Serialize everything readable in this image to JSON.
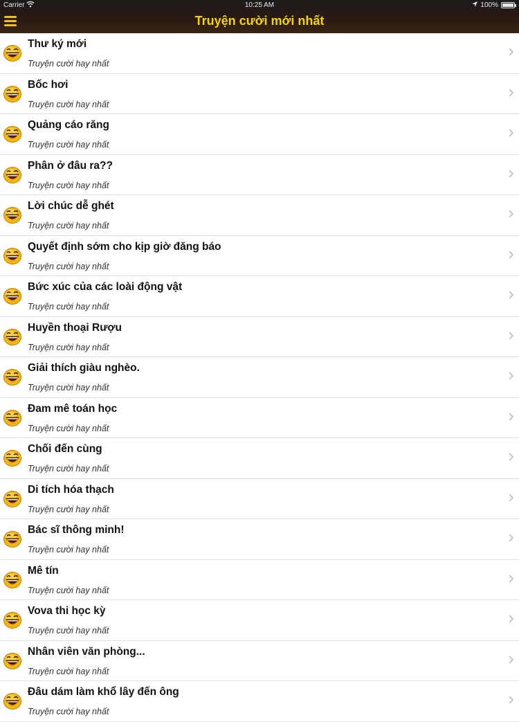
{
  "status_bar": {
    "carrier": "Carrier",
    "time": "10:25 AM",
    "battery": "100%",
    "battery_level": 1.0
  },
  "header": {
    "title": "Truyện cười mới nhất",
    "menu_icon": "hamburger-menu-icon"
  },
  "colors": {
    "header_title": "#f5d400",
    "menu_icon": "#f2c500",
    "header_bg": "#1b1b1b"
  },
  "list": {
    "items": [
      {
        "title": "Thư ký mới",
        "subtitle": "Truyện cười hay nhất"
      },
      {
        "title": "Bốc hơi",
        "subtitle": "Truyện cười hay nhất"
      },
      {
        "title": "Quảng cáo răng",
        "subtitle": "Truyện cười hay nhất"
      },
      {
        "title": "Phân ở đâu ra??",
        "subtitle": "Truyện cười hay nhất"
      },
      {
        "title": "Lời chúc dễ ghét",
        "subtitle": "Truyện cười hay nhất"
      },
      {
        "title": "Quyết định sớm cho kịp giờ đăng báo",
        "subtitle": "Truyện cười hay nhất"
      },
      {
        "title": "Bức xúc của các loài động vật",
        "subtitle": "Truyện cười hay nhất"
      },
      {
        "title": "Huyền thoại Rượu",
        "subtitle": "Truyện cười hay nhất"
      },
      {
        "title": "Giải thích giàu nghèo.",
        "subtitle": "Truyện cười hay nhất"
      },
      {
        "title": "Đam mê toán học",
        "subtitle": "Truyện cười hay nhất"
      },
      {
        "title": "Chối đến cùng",
        "subtitle": "Truyện cười hay nhất"
      },
      {
        "title": "Di tích hóa thạch",
        "subtitle": "Truyện cười hay nhất"
      },
      {
        "title": "Bác sĩ thông minh!",
        "subtitle": "Truyện cười hay nhất"
      },
      {
        "title": "Mê tín",
        "subtitle": "Truyện cười hay nhất"
      },
      {
        "title": "Vova thi học kỳ",
        "subtitle": "Truyện cười hay nhất"
      },
      {
        "title": "Nhân viên văn phòng...",
        "subtitle": "Truyện cười hay nhất"
      },
      {
        "title": "Đâu dám làm khổ lây đến ông",
        "subtitle": "Truyện cười hay nhất"
      }
    ]
  }
}
